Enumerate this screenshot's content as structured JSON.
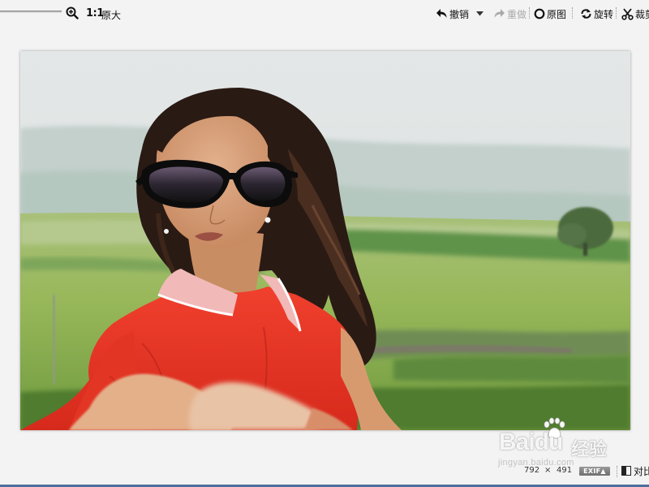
{
  "toolbar": {
    "one_to_one": "1:1",
    "original_size": "原大",
    "undo": "撤销",
    "redo": "重做",
    "original_image": "原图",
    "rotate": "旋转",
    "crop": "裁剪"
  },
  "status": {
    "width": "792",
    "times": "×",
    "height": "491",
    "exif": "EXIF▲",
    "compare": "对比"
  },
  "watermark": {
    "logo": "Baidu",
    "cn": "经验",
    "url": "jingyan.baidu.com"
  },
  "colors": {
    "background": "#f3f3f3",
    "disabled_text": "#a9a9a9",
    "accent_bar": "#4d6f9c"
  }
}
